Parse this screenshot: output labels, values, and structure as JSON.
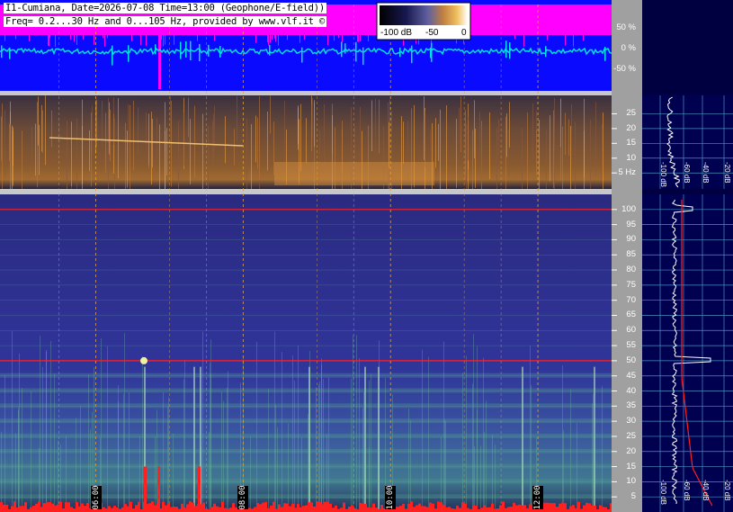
{
  "header": {
    "line1": "I1-Cumiana, Date=2026-07-08 Time=13:00 (Geophone/E-field))",
    "line2": "Freq= 0.2...30 Hz and 0...105 Hz, provided by www.vlf.it ©"
  },
  "colorbar": {
    "tick_labels": [
      "-100 dB",
      "-50",
      "0"
    ]
  },
  "colors": {
    "waveform_bg": "#0a0aff",
    "magenta_trace": "#ff00ff",
    "cyan_trace": "#00e0e0",
    "spectrum_bg": "#000080",
    "side_bg": "#000040",
    "tick_gray": "#a0a0a0",
    "grid_line": "#e8a020",
    "marker_red": "#ff2020"
  },
  "chart_data": [
    {
      "type": "line",
      "panel": "waveform",
      "y_tick_labels": [
        "50 %",
        "0 %",
        "-50 %"
      ],
      "ylim": [
        -100,
        100
      ],
      "series": [
        {
          "color": "#ff00ff",
          "level_percent": 75
        },
        {
          "color": "#00e0e0",
          "level_percent": 0
        }
      ]
    },
    {
      "type": "heatmap",
      "panel": "spectrogram-low",
      "y_tick_labels": [
        "25",
        "20",
        "15",
        "10",
        "5 Hz"
      ],
      "y_ticks": [
        25,
        20,
        15,
        10,
        5
      ],
      "ylim": [
        0.2,
        30
      ],
      "grid": true
    },
    {
      "type": "heatmap",
      "panel": "spectrogram-high",
      "y_tick_labels": [
        "100",
        "95",
        "90",
        "85",
        "80",
        "75",
        "70",
        "65",
        "60",
        "55",
        "50",
        "45",
        "40",
        "35",
        "30",
        "25",
        "20",
        "15",
        "10",
        "5"
      ],
      "y_ticks": [
        100,
        95,
        90,
        85,
        80,
        75,
        70,
        65,
        60,
        55,
        50,
        45,
        40,
        35,
        30,
        25,
        20,
        15,
        10,
        5
      ],
      "ylim": [
        0,
        105
      ],
      "x_tick_labels": [
        "06:00",
        "08:00",
        "10:00",
        "12:00"
      ],
      "x_ticks_hours": [
        6,
        8,
        10,
        12
      ],
      "xlim_hours": [
        4.7,
        13
      ],
      "marker_lines_hz": [
        100,
        50
      ],
      "grid": true
    },
    {
      "type": "line",
      "panel": "side-spectrum-low",
      "x_tick_labels": [
        "-100 dB",
        "-60 dB",
        "-40 dB",
        "-20 dB"
      ]
    },
    {
      "type": "line",
      "panel": "side-spectrum-high",
      "x_tick_labels": [
        "-100 dB",
        "-60 dB",
        "-40 dB",
        "-20 dB"
      ]
    }
  ]
}
